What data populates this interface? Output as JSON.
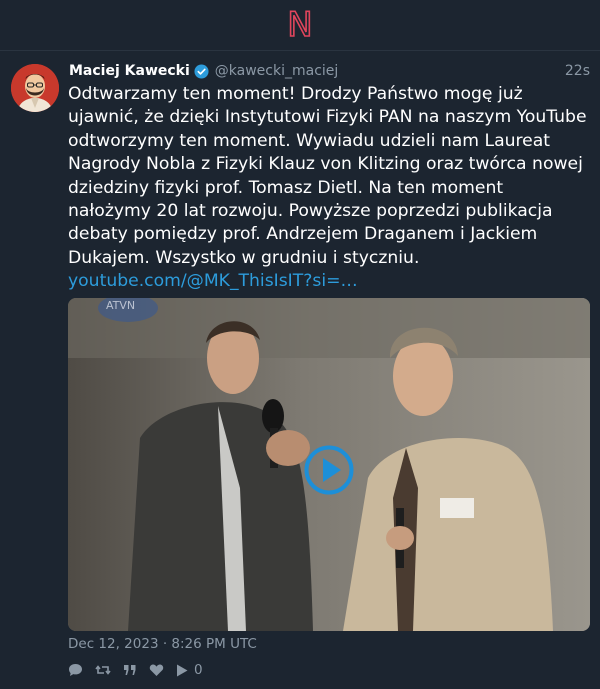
{
  "app": {
    "logo_letter": "N"
  },
  "tweet": {
    "author_name": "Maciej Kawecki",
    "handle": "@kawecki_maciej",
    "time_ago": "22s",
    "verified": true,
    "text": "Odtwarzamy ten moment! Drodzy Państwo mogę już ujawnić, że dzięki Instytutowi Fizyki PAN na naszym YouTube odtworzymy ten moment. Wywiadu udzieli nam Laureat Nagrody Nobla z Fizyki Klauz von Klitzing oraz twórca nowej dziedziny fizyki prof. Tomasz Dietl. Na ten moment nałożymy 20 lat rozwoju. Powyższe poprzedzi publikacja debaty pomiędzy prof. Andrzejem Draganem i Jackiem Dukajem. Wszystko w grudniu i styczniu. ",
    "link_text": "youtube.com/@MK_ThisIsIT?si=…",
    "media": {
      "type": "video",
      "watermark": "ATVN"
    },
    "date": "Dec 12, 2023 · 8:26 PM UTC",
    "play_count": "0"
  },
  "colors": {
    "background": "#1c2530",
    "accent_link": "#2d9cdb",
    "logo": "#e0455c",
    "muted": "#8b98a5"
  },
  "icons": [
    "reply-icon",
    "retweet-icon",
    "quote-icon",
    "like-icon",
    "play-count-icon"
  ]
}
